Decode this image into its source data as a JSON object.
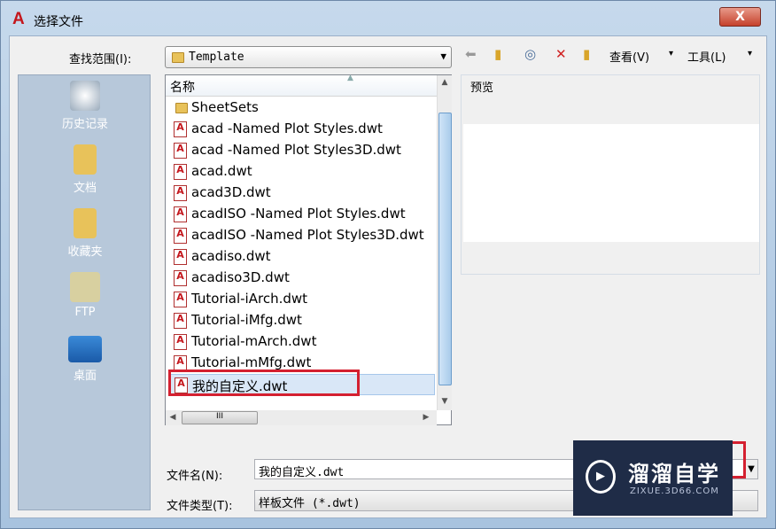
{
  "window": {
    "title": "选择文件",
    "close_label": "X"
  },
  "lookin": {
    "label": "查找范围(I):",
    "value": "Template"
  },
  "toolbar": {
    "view_label": "查看(V)",
    "tools_label": "工具(L)"
  },
  "places": [
    {
      "label": "历史记录"
    },
    {
      "label": "文档"
    },
    {
      "label": "收藏夹"
    },
    {
      "label": "FTP"
    },
    {
      "label": "桌面"
    }
  ],
  "list": {
    "header": "名称",
    "items": [
      "SheetSets",
      "acad -Named Plot Styles.dwt",
      "acad -Named Plot Styles3D.dwt",
      "acad.dwt",
      "acad3D.dwt",
      "acadISO -Named Plot Styles.dwt",
      "acadISO -Named Plot Styles3D.dwt",
      "acadiso.dwt",
      "acadiso3D.dwt",
      "Tutorial-iArch.dwt",
      "Tutorial-iMfg.dwt",
      "Tutorial-mArch.dwt",
      "Tutorial-mMfg.dwt",
      "我的自定义.dwt"
    ],
    "selected": "我的自定义.dwt"
  },
  "preview": {
    "label": "预览"
  },
  "filename": {
    "label": "文件名(N):",
    "value": "我的自定义.dwt"
  },
  "filetype": {
    "label": "文件类型(T):",
    "value": "样板文件 (*.dwt)"
  },
  "watermark": {
    "brand": "溜溜自学",
    "url": "ZIXUE.3D66.COM"
  },
  "colors": {
    "highlight": "#d42030",
    "places_bg": "#b7c8da",
    "watermark_bg": "#1f2c47"
  }
}
